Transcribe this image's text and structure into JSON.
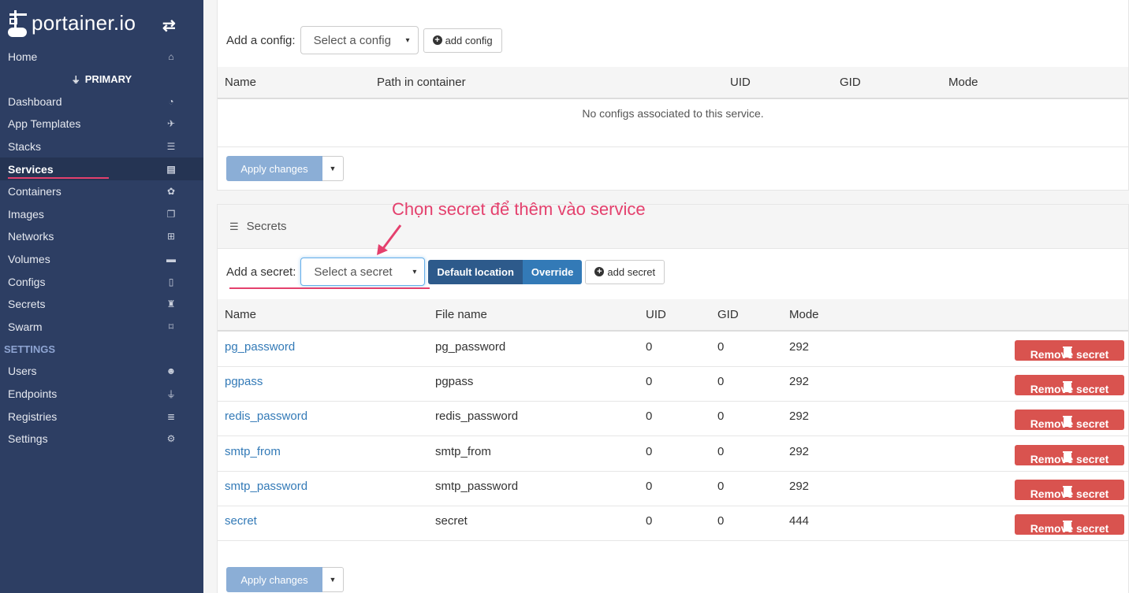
{
  "sidebar": {
    "logo_text": "portainer.io",
    "toggle_icon": "exchange-icon",
    "home": {
      "label": "Home",
      "icon": "home-icon"
    },
    "endpoint_name": "PRIMARY",
    "items": [
      {
        "label": "Dashboard",
        "icon": "dashboard-icon",
        "glyph": "◔"
      },
      {
        "label": "App Templates",
        "icon": "rocket-icon",
        "glyph": "✈"
      },
      {
        "label": "Stacks",
        "icon": "list-icon",
        "glyph": "☰"
      },
      {
        "label": "Services",
        "icon": "services-icon",
        "glyph": "▤",
        "active": true
      },
      {
        "label": "Containers",
        "icon": "cubes-icon",
        "glyph": "✿"
      },
      {
        "label": "Images",
        "icon": "clone-icon",
        "glyph": "❐"
      },
      {
        "label": "Networks",
        "icon": "sitemap-icon",
        "glyph": "⊞"
      },
      {
        "label": "Volumes",
        "icon": "hdd-icon",
        "glyph": "▬"
      },
      {
        "label": "Configs",
        "icon": "file-code-icon",
        "glyph": "▯"
      },
      {
        "label": "Secrets",
        "icon": "user-secret-icon",
        "glyph": "♜"
      },
      {
        "label": "Swarm",
        "icon": "object-group-icon",
        "glyph": "⌑"
      }
    ],
    "settings_heading": "SETTINGS",
    "settings_items": [
      {
        "label": "Users",
        "icon": "users-icon",
        "glyph": "☻"
      },
      {
        "label": "Endpoints",
        "icon": "plug-icon",
        "glyph": "⏚"
      },
      {
        "label": "Registries",
        "icon": "database-icon",
        "glyph": "≣"
      },
      {
        "label": "Settings",
        "icon": "cogs-icon",
        "glyph": "⚙"
      }
    ]
  },
  "configs": {
    "add_label": "Add a config:",
    "select_placeholder": "Select a config",
    "add_button": "add config",
    "columns": [
      "Name",
      "Path in container",
      "UID",
      "GID",
      "Mode"
    ],
    "empty_message": "No configs associated to this service.",
    "apply_button": "Apply changes"
  },
  "secrets": {
    "title": "Secrets",
    "add_label": "Add a secret:",
    "select_placeholder": "Select a secret",
    "location_default": "Default location",
    "location_override": "Override",
    "add_button": "add secret",
    "columns": [
      "Name",
      "File name",
      "UID",
      "GID",
      "Mode"
    ],
    "rows": [
      {
        "name": "pg_password",
        "file": "pg_password",
        "uid": "0",
        "gid": "0",
        "mode": "292"
      },
      {
        "name": "pgpass",
        "file": "pgpass",
        "uid": "0",
        "gid": "0",
        "mode": "292"
      },
      {
        "name": "redis_password",
        "file": "redis_password",
        "uid": "0",
        "gid": "0",
        "mode": "292"
      },
      {
        "name": "smtp_from",
        "file": "smtp_from",
        "uid": "0",
        "gid": "0",
        "mode": "292"
      },
      {
        "name": "smtp_password",
        "file": "smtp_password",
        "uid": "0",
        "gid": "0",
        "mode": "292"
      },
      {
        "name": "secret",
        "file": "secret",
        "uid": "0",
        "gid": "0",
        "mode": "444"
      }
    ],
    "remove_button": "Remove secret",
    "apply_button": "Apply changes"
  },
  "annotation": {
    "text": "Chọn secret để thêm vào service",
    "color": "#e4406d"
  },
  "colors": {
    "sidebar_bg": "#2d3e63",
    "accent_pink": "#e4406d",
    "link_blue": "#337ab7",
    "danger": "#d9534f",
    "apply_disabled": "#8baed6"
  }
}
